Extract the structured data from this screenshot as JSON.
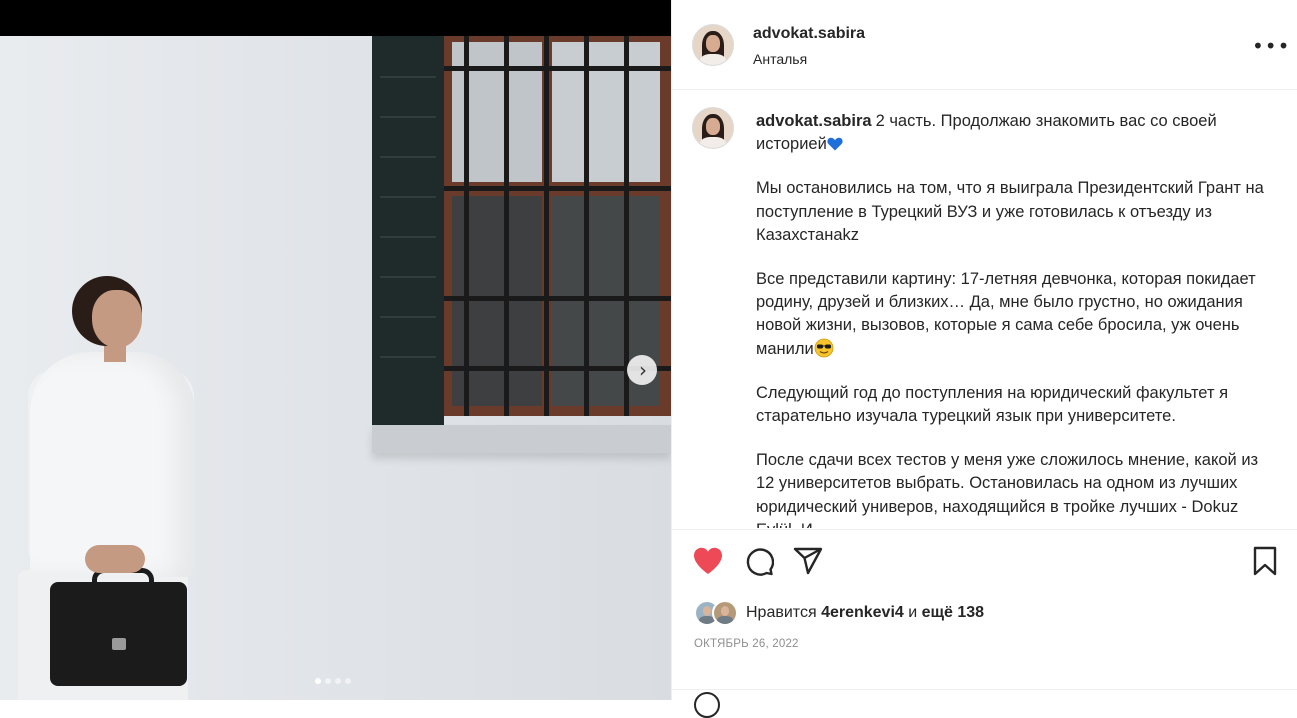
{
  "post": {
    "username": "advokat.sabira",
    "location": "Анталья",
    "more_label": "•••",
    "caption": {
      "username": "advokat.sabira",
      "first_line": "2 часть. Продолжаю знакомить вас со своей историей",
      "paragraphs": [
        "Мы остановились на том, что я выиграла Президентский Грант на поступление в Турецкий ВУЗ и уже готовилась к отъезду из Казахстанаkz",
        "Все представили картину: 17-летняя девчонка, которая покидает родину, друзей и близких… Да, мне было грустно, но ожидания новой жизни, вызовов, которые я сама себе бросила, уж очень манили",
        "Следующий год до поступления на юридический факультет я старательно изучала турецкий язык при университете.",
        "После сдачи всех тестов у меня уже сложилось мнение, какой из 12 университетов выбрать. Остановилась на одном из лучших юридический универов, находящийся в тройке лучших - Dokuz Eylül. И..."
      ]
    },
    "likes": {
      "prefix": "Нравится",
      "user": "4erenkevi4",
      "joiner": "и",
      "rest": "ещё 138"
    },
    "date": "ОКТЯБРЬ 26, 2022",
    "carousel": {
      "total": 4,
      "active": 1
    },
    "colors": {
      "like": "#ed4956",
      "text": "#262626",
      "muted": "#8e8e8e",
      "heart_emoji": "#1e6fd9"
    },
    "icons": [
      "heart-icon",
      "comment-icon",
      "share-icon",
      "bookmark-icon",
      "chevron-right-icon",
      "more-icon"
    ]
  }
}
